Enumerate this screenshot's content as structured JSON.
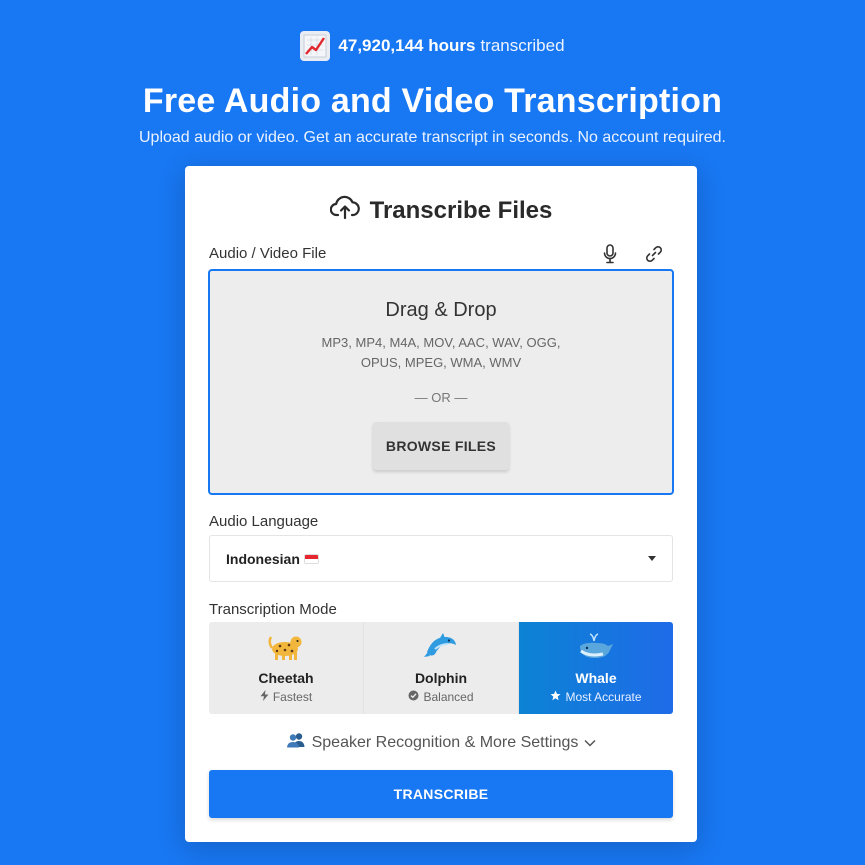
{
  "stats": {
    "count": "47,920,144 hours",
    "suffix": "transcribed",
    "icon": "chart-increasing-icon"
  },
  "hero": {
    "title": "Free Audio and Video Transcription",
    "subtitle": "Upload audio or video. Get an accurate transcript in seconds. No account required."
  },
  "card": {
    "title": "Transcribe Files",
    "file_label": "Audio / Video File",
    "tools": [
      "microphone-icon",
      "link-icon"
    ],
    "dropzone": {
      "title": "Drag & Drop",
      "formats_line1": "MP3, MP4, M4A, MOV, AAC, WAV, OGG,",
      "formats_line2": "OPUS, MPEG, WMA, WMV",
      "or": "— OR —",
      "browse": "BROWSE FILES"
    },
    "language_label": "Audio Language",
    "language_value": "Indonesian",
    "mode_label": "Transcription Mode",
    "modes": [
      {
        "name": "Cheetah",
        "desc": "Fastest",
        "icon": "lightning-icon",
        "emoji": "leopard",
        "active": false
      },
      {
        "name": "Dolphin",
        "desc": "Balanced",
        "icon": "check-circle-icon",
        "emoji": "dolphin",
        "active": false
      },
      {
        "name": "Whale",
        "desc": "Most Accurate",
        "icon": "star-icon",
        "emoji": "whale",
        "active": true
      }
    ],
    "more_settings": "Speaker Recognition & More Settings",
    "transcribe": "TRANSCRIBE"
  },
  "colors": {
    "brand": "#1877f2",
    "active_mode_start": "#0c83d4",
    "active_mode_end": "#1f6be8"
  }
}
